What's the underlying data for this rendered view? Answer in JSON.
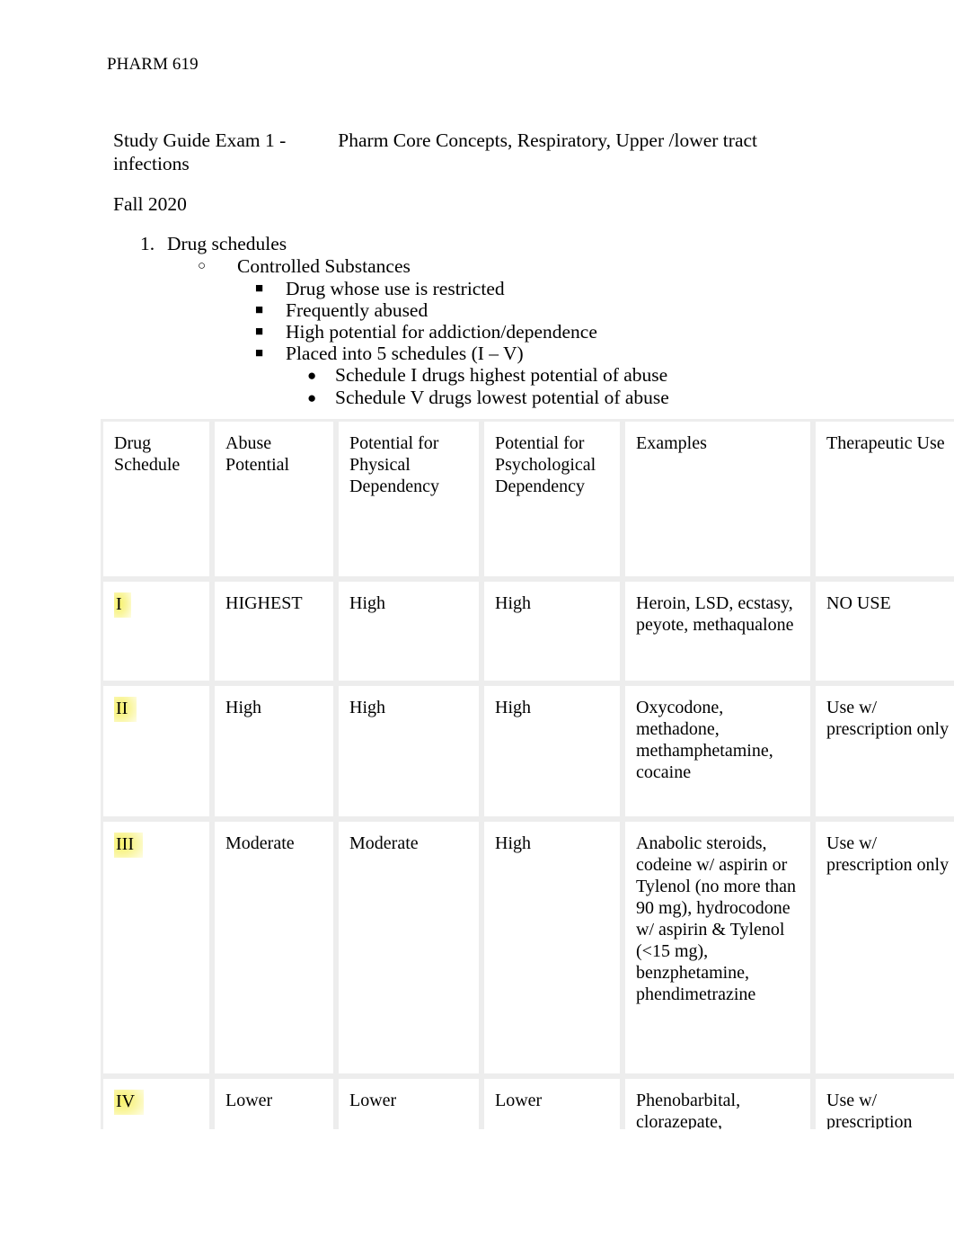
{
  "document": {
    "running_head": "PHARM 619",
    "title_part1": "Study Guide Exam 1 -",
    "title_part2": "Pharm Core Concepts, Respiratory, Upper /lower tract",
    "title_part3": "infections",
    "term": "Fall 2020"
  },
  "outline": {
    "item1_marker": "1.",
    "item1": "Drug schedules",
    "item2_marker": "○",
    "item2": "Controlled Substances",
    "item3_marker": "■",
    "item3": " Drug whose use is restricted",
    "item4_marker": "■",
    "item4": " Frequently abused",
    "item5_marker": "■",
    "item5": "High potential for addiction/dependence",
    "item6_marker": "■",
    "item6": "Placed into 5 schedules (I – V)",
    "item7_marker": "●",
    "item7": "Schedule I drugs highest potential of abuse",
    "item8_marker": "●",
    "item8": "Schedule V drugs lowest potential of abuse"
  },
  "table": {
    "headers": [
      "Drug Schedule",
      "Abuse Potential",
      "Potential for Physical Dependency",
      "Potential for Psychological Dependency",
      "Examples",
      "Therapeutic Use"
    ],
    "rows": [
      {
        "schedule": "I",
        "abuse_potential": "HIGHEST",
        "physical_dependency": "High",
        "psychological_dependency": "High",
        "examples": "Heroin, LSD, ecstasy, peyote, methaqualone",
        "therapeutic_use": "NO USE"
      },
      {
        "schedule": "II",
        "abuse_potential": "High",
        "physical_dependency": "High",
        "psychological_dependency": "High",
        "examples": "Oxycodone, methadone, methamphetamine, cocaine",
        "therapeutic_use": "Use w/ prescription only"
      },
      {
        "schedule": "III",
        "abuse_potential": "Moderate",
        "physical_dependency": "Moderate",
        "psychological_dependency": "High",
        "examples": "Anabolic steroids, codeine w/ aspirin or Tylenol (no more than 90 mg), hydrocodone w/ aspirin & Tylenol (<15 mg), benzphetamine, phendimetrazine",
        "therapeutic_use": "Use w/ prescription only"
      },
      {
        "schedule": "IV",
        "abuse_potential": "Lower",
        "physical_dependency": "Lower",
        "psychological_dependency": "Lower",
        "examples": "Phenobarbital, clorazepate,",
        "therapeutic_use": "Use w/ prescription"
      }
    ]
  },
  "colors": {
    "highlight": "#f7f26a",
    "text": "#000000",
    "border": "#ededed",
    "background": "#ffffff"
  }
}
